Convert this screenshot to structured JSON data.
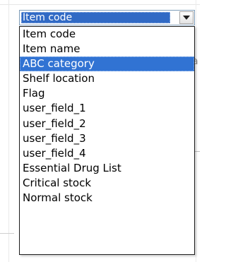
{
  "combo": {
    "selected_value": "Item code"
  },
  "list": {
    "items": [
      {
        "label": "Item code"
      },
      {
        "label": "Item name"
      },
      {
        "label": "ABC category"
      },
      {
        "label": "Shelf location"
      },
      {
        "label": "Flag"
      },
      {
        "label": "user_field_1"
      },
      {
        "label": "user_field_2"
      },
      {
        "label": "user_field_3"
      },
      {
        "label": "user_field_4"
      },
      {
        "label": "Essential Drug List"
      },
      {
        "label": "Critical stock"
      },
      {
        "label": "Normal stock"
      }
    ],
    "highlighted_index": 2
  },
  "background": {
    "partial_text": "a"
  },
  "colors": {
    "selection": "#316ac5",
    "highlight": "#3173d3",
    "combo_border": "#7f9db9",
    "list_border": "#1c1c1c"
  }
}
